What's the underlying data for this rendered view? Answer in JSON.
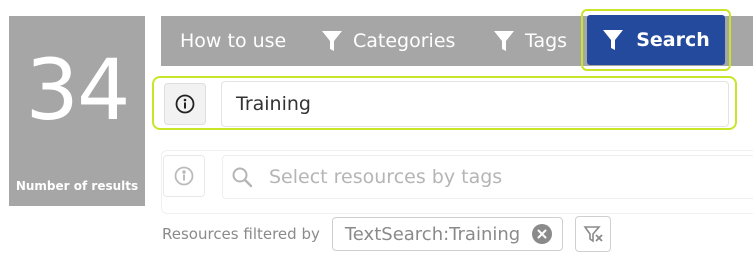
{
  "results": {
    "count": "34",
    "label": "Number of results"
  },
  "tabs": {
    "how_to_use": "How to use",
    "categories": "Categories",
    "tags": "Tags",
    "search": "Search"
  },
  "search": {
    "value": "Training"
  },
  "tags": {
    "placeholder": "Select resources by tags"
  },
  "filters": {
    "label": "Resources filtered by",
    "active": "TextSearch:Training"
  },
  "colors": {
    "panel_gray": "#a6a6a6",
    "active_tab": "#234a9d",
    "highlight": "#c9e52a"
  },
  "icons": [
    "filter-icon",
    "info-icon",
    "search-icon",
    "close-icon",
    "clear-filter-icon"
  ]
}
